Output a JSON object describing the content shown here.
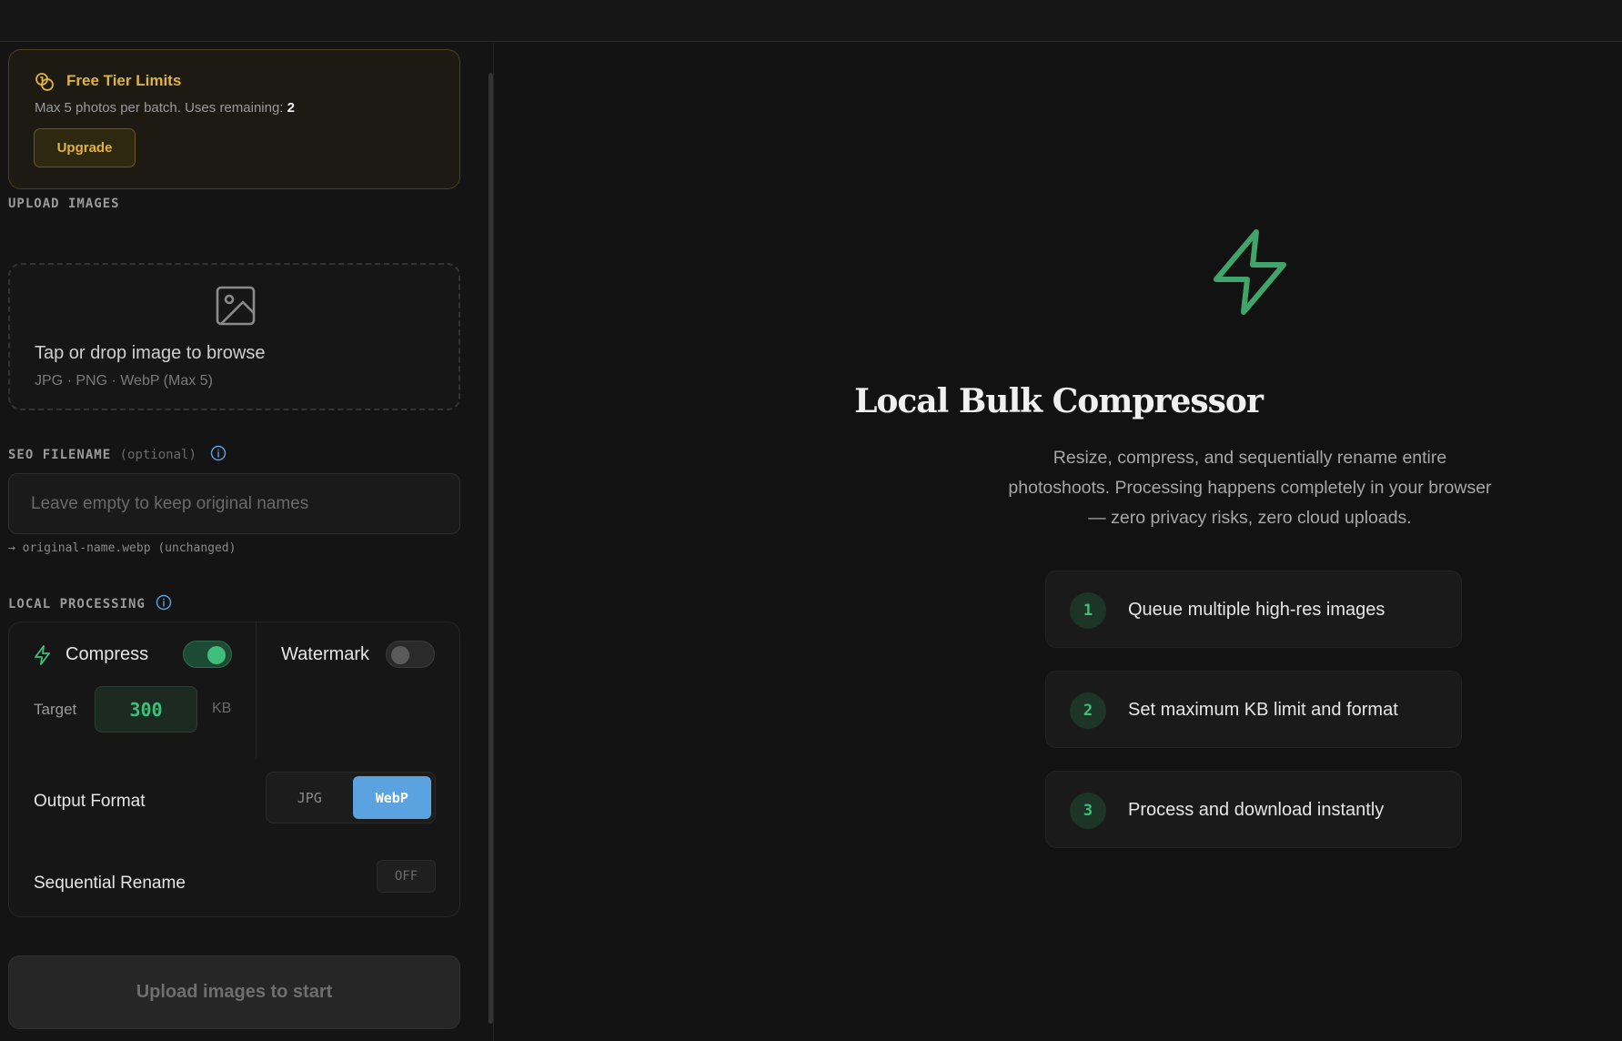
{
  "free_tier": {
    "title": "Free Tier Limits",
    "desc": "Max 5 photos per batch. Uses remaining: ",
    "uses_remaining": "2",
    "upgrade_label": "Upgrade"
  },
  "upload": {
    "section_label": "UPLOAD IMAGES",
    "title": "Tap or drop image to browse",
    "formats": "JPG · PNG · WebP (Max 5)"
  },
  "seo": {
    "section_label": "SEO FILENAME",
    "optional": "(optional)",
    "placeholder": "Leave empty to keep original names",
    "value": "",
    "preview": "→ original-name.webp (unchanged)"
  },
  "processing": {
    "section_label": "LOCAL PROCESSING",
    "compress_label": "Compress",
    "compress_on": true,
    "watermark_label": "Watermark",
    "watermark_on": false,
    "target_label": "Target",
    "target_value": "300",
    "target_unit": "KB",
    "format_label": "Output Format",
    "formats": [
      "JPG",
      "WebP"
    ],
    "selected_format": "WebP",
    "rename_label": "Sequential Rename",
    "rename_state": "OFF"
  },
  "start_button": "Upload images to start",
  "hero": {
    "title": "Local Bulk Compressor",
    "description": "Resize, compress, and sequentially rename entire photoshoots. Processing happens completely in your browser — zero privacy risks, zero cloud uploads.",
    "steps": [
      {
        "num": "1",
        "text": "Queue multiple high-res images"
      },
      {
        "num": "2",
        "text": "Set maximum KB limit and format"
      },
      {
        "num": "3",
        "text": "Process and download instantly"
      }
    ]
  },
  "colors": {
    "accent_green": "#3fbf7a",
    "accent_gold": "#e2b33c",
    "accent_blue": "#5aa3e0",
    "background": "#121212"
  },
  "icons": [
    "coins-icon",
    "image-icon",
    "info-icon",
    "lightning-icon"
  ]
}
